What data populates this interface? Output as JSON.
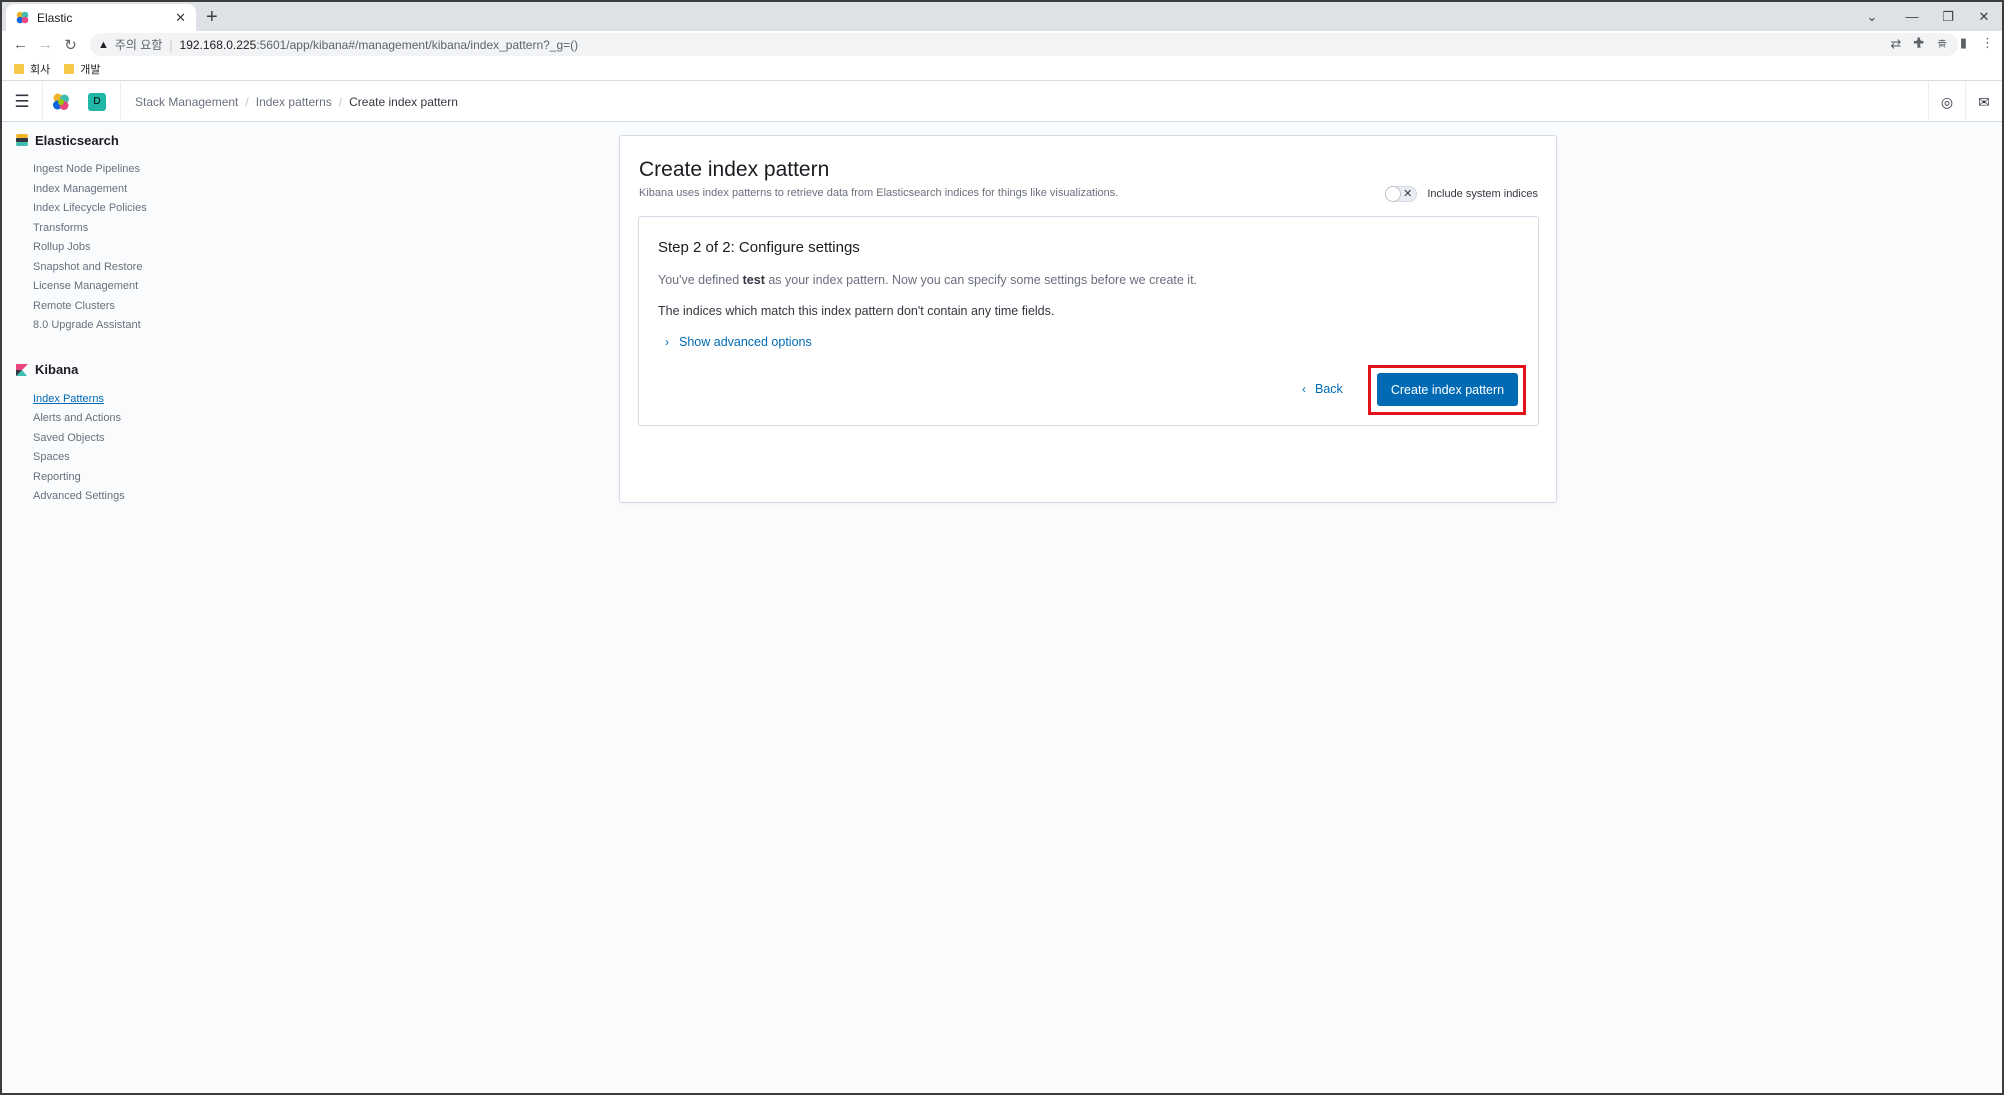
{
  "browser": {
    "tab_title": "Elastic",
    "new_tab": "+",
    "security_label": "주의 요함",
    "url_host": "192.168.0.225",
    "url_path": ":5601/app/kibana#/management/kibana/index_pattern?_g=()",
    "bookmarks": [
      "회사",
      "개발"
    ]
  },
  "header": {
    "space_initial": "D",
    "breadcrumbs": [
      "Stack Management",
      "Index patterns",
      "Create index pattern"
    ]
  },
  "sidebar": {
    "elasticsearch_title": "Elasticsearch",
    "elasticsearch_items": [
      "Ingest Node Pipelines",
      "Index Management",
      "Index Lifecycle Policies",
      "Transforms",
      "Rollup Jobs",
      "Snapshot and Restore",
      "License Management",
      "Remote Clusters",
      "8.0 Upgrade Assistant"
    ],
    "kibana_title": "Kibana",
    "kibana_items": [
      "Index Patterns",
      "Alerts and Actions",
      "Saved Objects",
      "Spaces",
      "Reporting",
      "Advanced Settings"
    ],
    "active_item": "Index Patterns"
  },
  "main": {
    "title": "Create index pattern",
    "description": "Kibana uses index patterns to retrieve data from Elasticsearch indices for things like visualizations.",
    "toggle_label": "Include system indices",
    "toggle_on": false,
    "step": {
      "title": "Step 2 of 2: Configure settings",
      "line1_prefix": "You've defined ",
      "pattern_name": "test",
      "line1_suffix": " as your index pattern. Now you can specify some settings before we create it.",
      "line2": "The indices which match this index pattern don't contain any time fields.",
      "advanced_link": "Show advanced options",
      "back_label": "Back",
      "create_label": "Create index pattern"
    }
  },
  "colors": {
    "primary": "#006bb4",
    "highlight": "#e3121a",
    "space_badge": "#20b7a7"
  }
}
